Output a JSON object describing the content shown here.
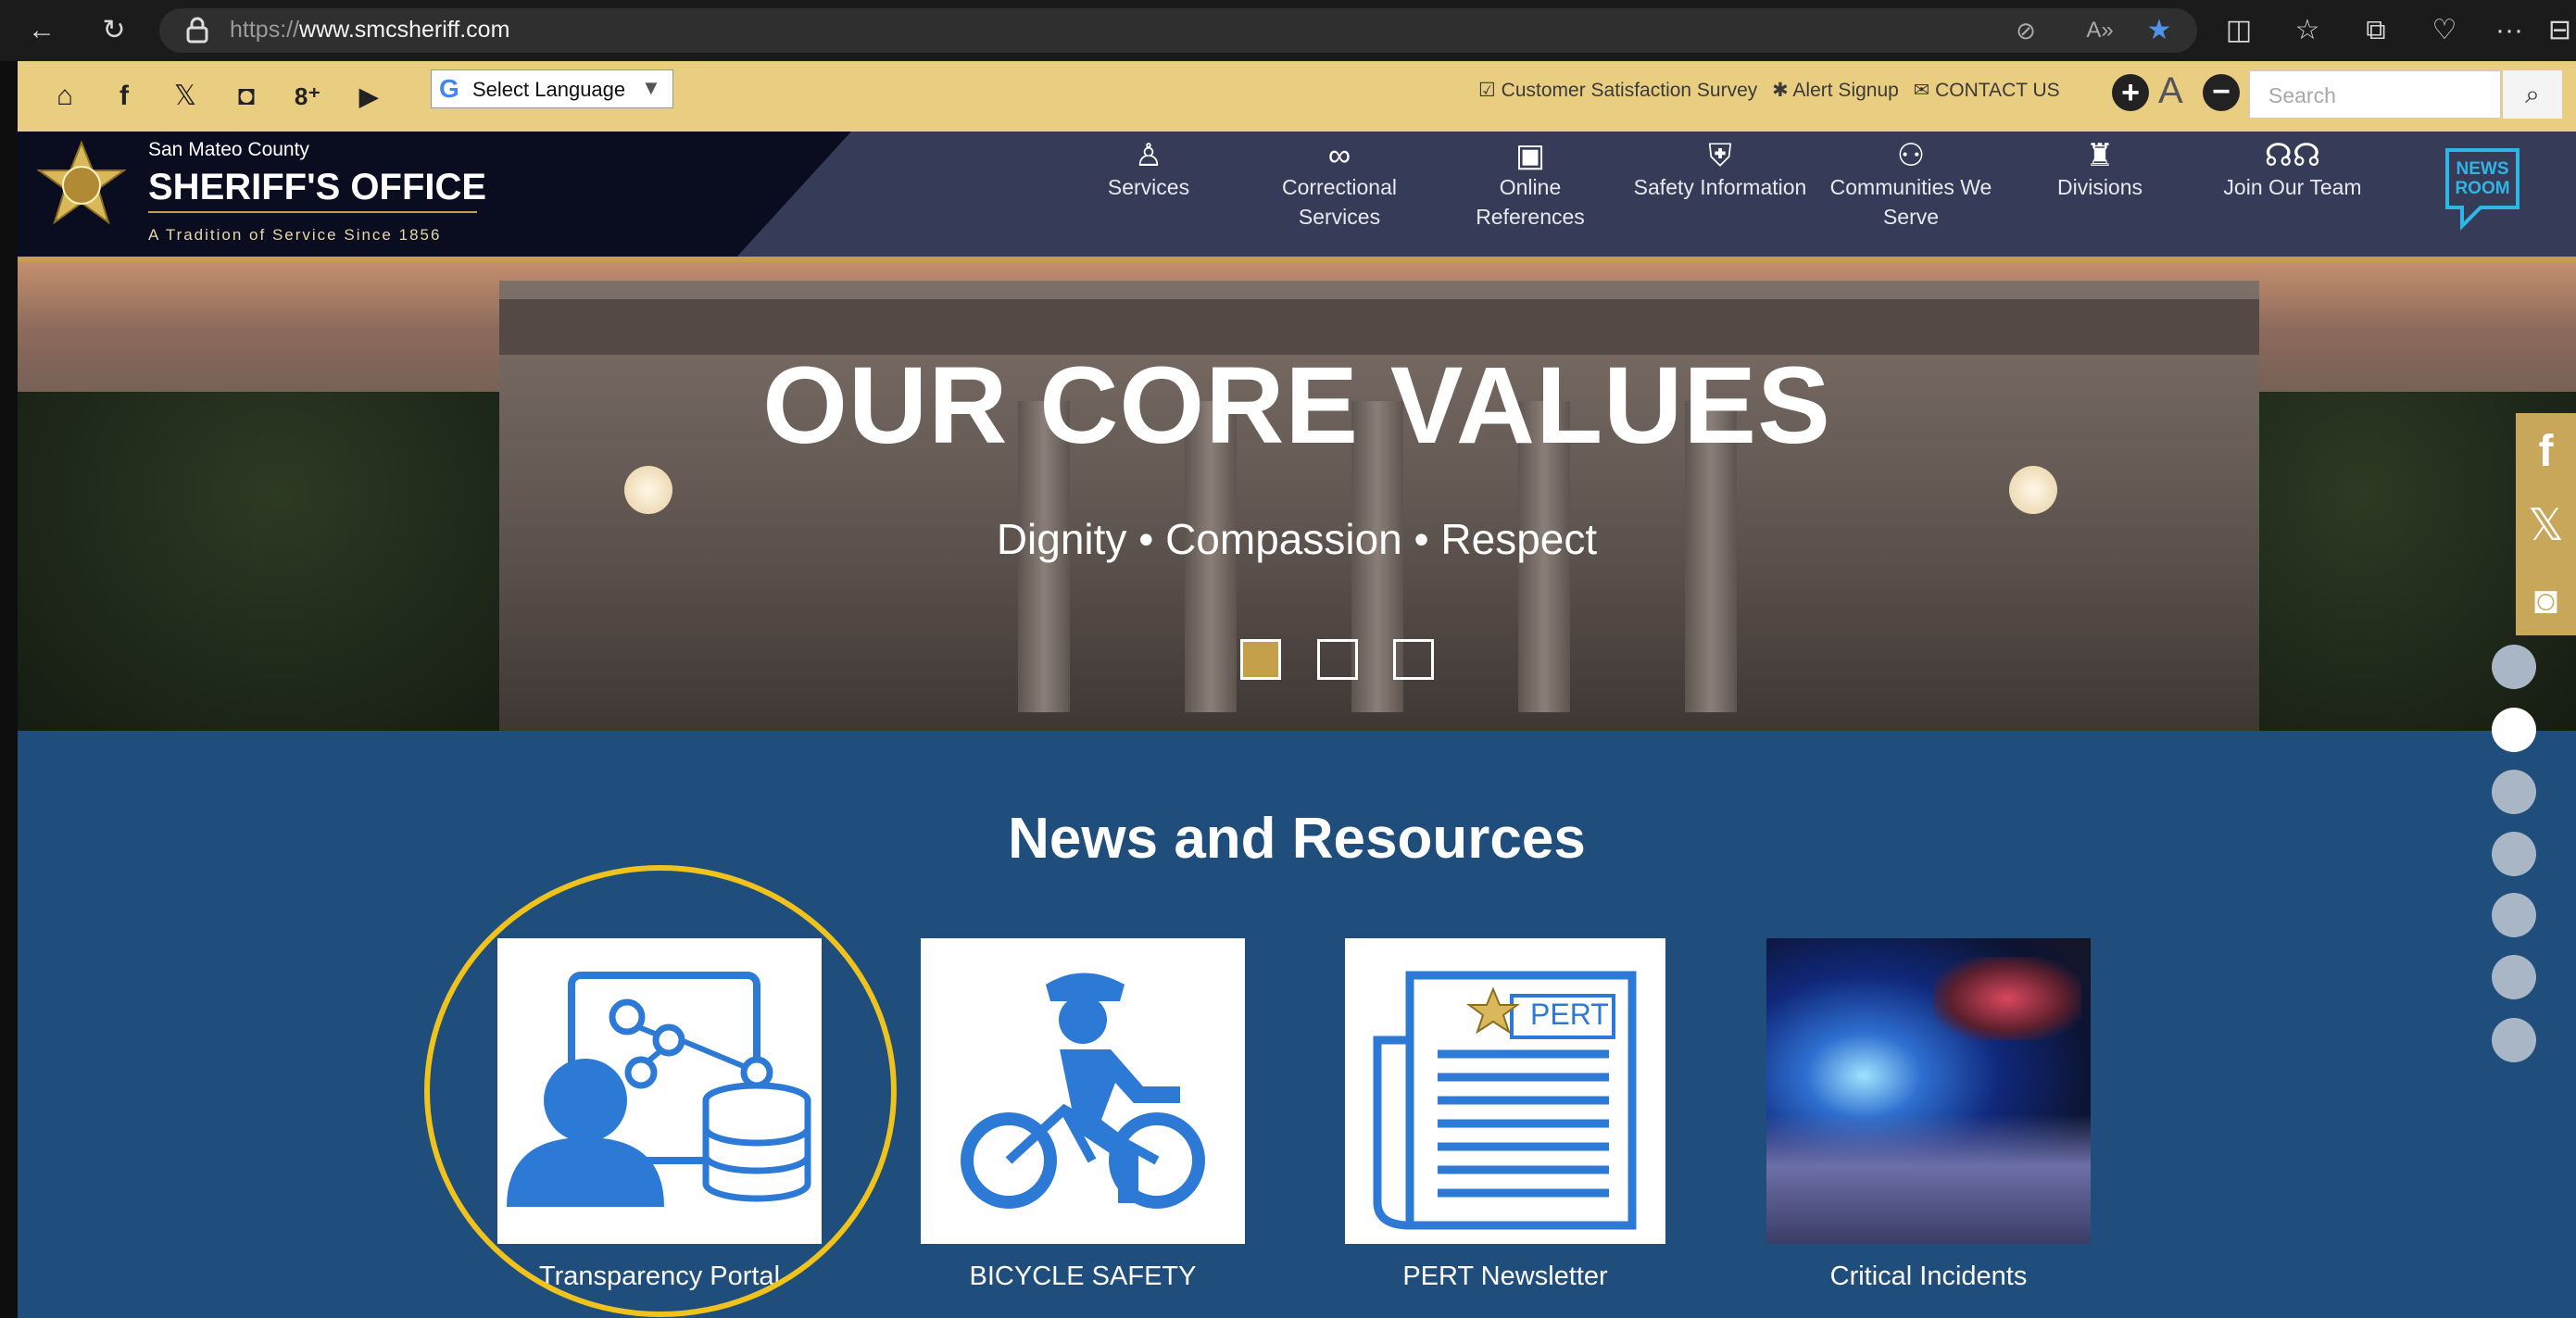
{
  "browser": {
    "url_prefix": "https://",
    "url_domain": "www.smcsheriff.com"
  },
  "utility": {
    "language_label": "Select Language",
    "survey_label": "Customer Satisfaction Survey",
    "alert_label": "Alert Signup",
    "contact_label": "CONTACT US",
    "font_size_label": "A",
    "search_placeholder": "Search"
  },
  "header": {
    "county": "San Mateo County",
    "title": "SHERIFF'S OFFICE",
    "tagline": "A Tradition of Service Since 1856",
    "newsroom_label": "NEWS ROOM"
  },
  "nav": [
    {
      "icon": "person-badge-icon",
      "label": "Services"
    },
    {
      "icon": "handcuffs-icon",
      "label": "Correctional Services"
    },
    {
      "icon": "monitor-icon",
      "label": "Online References"
    },
    {
      "icon": "shield-icon",
      "label": "Safety Information"
    },
    {
      "icon": "community-icon",
      "label": "Communities We Serve"
    },
    {
      "icon": "org-chart-icon",
      "label": "Divisions"
    },
    {
      "icon": "team-icon",
      "label": "Join Our Team"
    }
  ],
  "hero": {
    "title": "OUR CORE VALUES",
    "subtitle": "Dignity  •  Compassion  •  Respect",
    "slides": 3,
    "active_slide": 1
  },
  "main": {
    "heading": "News and Resources",
    "cards": [
      {
        "label": "Transparency Portal",
        "icon": "data-person-icon"
      },
      {
        "label": "BICYCLE SAFETY",
        "icon": "bicycle-icon"
      },
      {
        "label": "PERT Newsletter",
        "icon": "newsletter-icon",
        "badge": "PERT"
      },
      {
        "label": "Critical Incidents",
        "icon": "police-light-photo"
      }
    ]
  },
  "colors": {
    "gold": "#e9cd80",
    "navy": "#0a0d1f",
    "header": "#363c57",
    "main_blue": "#1f4d7c",
    "icon_blue": "#2d7ad6",
    "highlight": "#f0c21c"
  }
}
